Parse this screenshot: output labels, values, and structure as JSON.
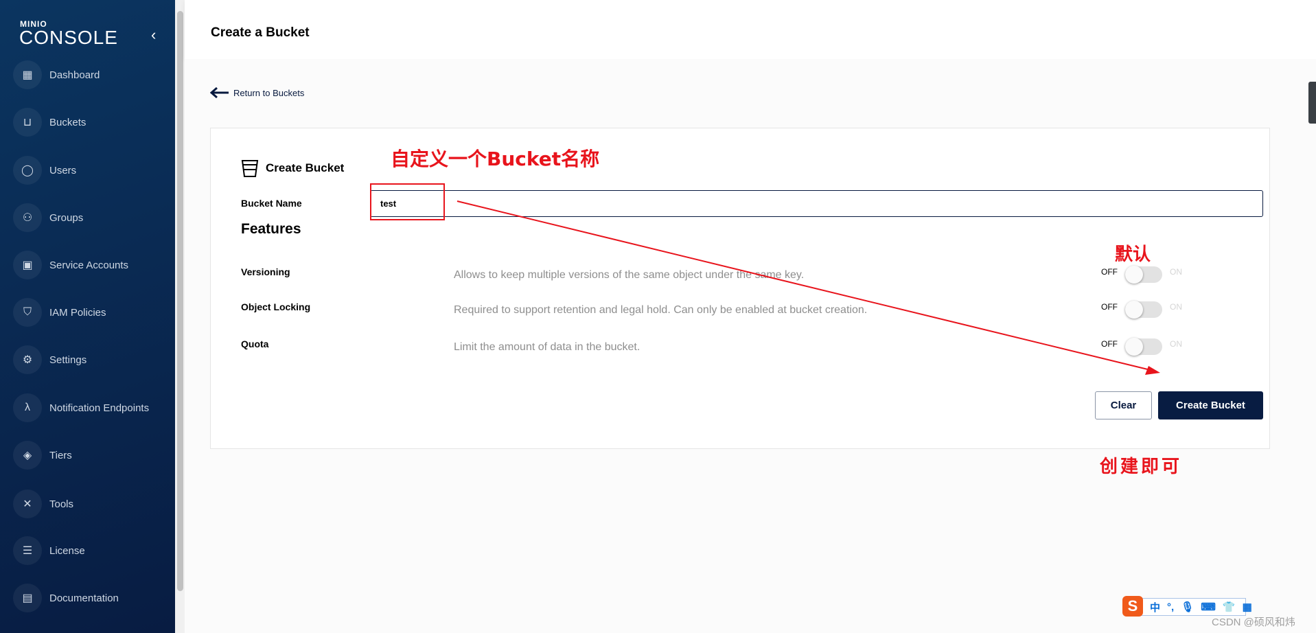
{
  "sidebar": {
    "logo_small": "MINIO",
    "logo_big": "CONSOLE",
    "items": [
      {
        "label": "Dashboard",
        "icon": "dashboard-icon"
      },
      {
        "label": "Buckets",
        "icon": "bucket-icon"
      },
      {
        "label": "Users",
        "icon": "user-icon"
      },
      {
        "label": "Groups",
        "icon": "groups-icon"
      },
      {
        "label": "Service Accounts",
        "icon": "service-accounts-icon"
      },
      {
        "label": "IAM Policies",
        "icon": "shield-icon"
      },
      {
        "label": "Settings",
        "icon": "gear-icon"
      },
      {
        "label": "Notification Endpoints",
        "icon": "lambda-icon"
      },
      {
        "label": "Tiers",
        "icon": "layers-icon"
      },
      {
        "label": "Tools",
        "icon": "tools-icon"
      },
      {
        "label": "License",
        "icon": "license-icon"
      },
      {
        "label": "Documentation",
        "icon": "document-icon"
      }
    ]
  },
  "header": {
    "title": "Create a Bucket"
  },
  "back_link": "Return to Buckets",
  "form": {
    "heading": "Create Bucket",
    "bucket_name_label": "Bucket Name",
    "bucket_name_value": "test",
    "features_title": "Features",
    "features": [
      {
        "name": "Versioning",
        "desc": "Allows to keep multiple versions of the same object under the same key.",
        "off": "OFF",
        "on": "ON",
        "enabled": false
      },
      {
        "name": "Object Locking",
        "desc": "Required to support retention and legal hold. Can only be enabled at bucket creation.",
        "off": "OFF",
        "on": "ON",
        "enabled": false
      },
      {
        "name": "Quota",
        "desc": "Limit the amount of data in the bucket.",
        "off": "OFF",
        "on": "ON",
        "enabled": false
      }
    ],
    "clear_label": "Clear",
    "create_label": "Create Bucket"
  },
  "annotations": {
    "name_hint": "自定义一个Bucket名称",
    "default_hint": "默认",
    "create_hint": "创建即可",
    "color": "#e8141c"
  },
  "ime": {
    "items": [
      "中",
      "°,"
    ]
  },
  "watermark": "CSDN @硕风和炜"
}
